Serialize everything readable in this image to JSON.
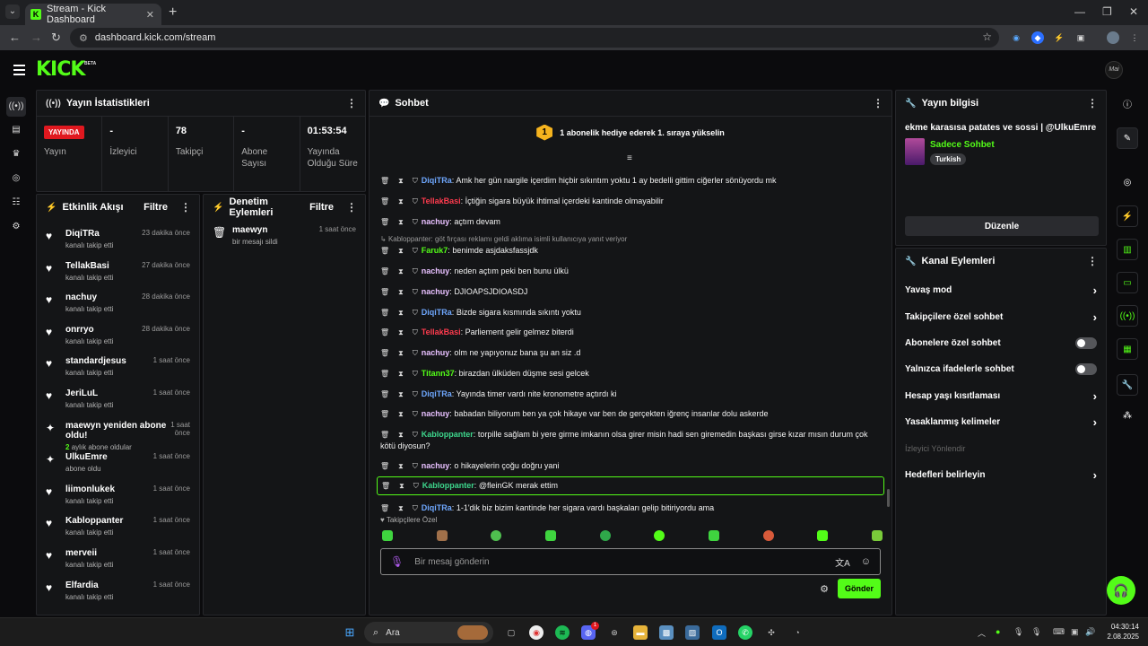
{
  "browser": {
    "tab_title": "Stream - Kick Dashboard",
    "url": "dashboard.kick.com/stream",
    "new_tab": "+",
    "favicon": "K",
    "tab_selector": "⌄"
  },
  "header": {
    "logo": "KICK",
    "beta": "BETA",
    "avatar_text": "Mai"
  },
  "stats": {
    "title": "Yayın İstatistikleri",
    "cells": [
      {
        "value": "YAYINDA",
        "label": "Yayın"
      },
      {
        "value": "-",
        "label": "İzleyici"
      },
      {
        "value": "78",
        "label": "Takipçi"
      },
      {
        "value": "-",
        "label": "Abone Sayısı"
      },
      {
        "value": "01:53:54",
        "label": "Yayında Olduğu Süre"
      }
    ]
  },
  "activity": {
    "title": "Etkinlik Akışı",
    "filter": "Filtre",
    "items": [
      {
        "icon": "heart",
        "name": "DiqiTRa",
        "sub": "kanalı takip etti",
        "time": "23 dakika önce"
      },
      {
        "icon": "heart",
        "name": "TellakBasi",
        "sub": "kanalı takip etti",
        "time": "27 dakika önce"
      },
      {
        "icon": "heart",
        "name": "nachuy",
        "sub": "kanalı takip etti",
        "time": "28 dakika önce"
      },
      {
        "icon": "heart",
        "name": "onrryo",
        "sub": "kanalı takip etti",
        "time": "28 dakika önce"
      },
      {
        "icon": "heart",
        "name": "standardjesus",
        "sub": "kanalı takip etti",
        "time": "1 saat önce"
      },
      {
        "icon": "heart",
        "name": "JeriLuL",
        "sub": "kanalı takip etti",
        "time": "1 saat önce"
      },
      {
        "icon": "sparkle",
        "name": "maewyn yeniden abone oldu!",
        "sub_green": "2",
        "sub": "aylık abone oldular",
        "time": "1 saat önce"
      },
      {
        "icon": "sparkle",
        "name": "UlkuEmre",
        "sub": "abone oldu",
        "time": "1 saat önce"
      },
      {
        "icon": "heart",
        "name": "liimonlukek",
        "sub": "kanalı takip etti",
        "time": "1 saat önce"
      },
      {
        "icon": "heart",
        "name": "Kabloppanter",
        "sub": "kanalı takip etti",
        "time": "1 saat önce"
      },
      {
        "icon": "heart",
        "name": "merveii",
        "sub": "kanalı takip etti",
        "time": "1 saat önce"
      },
      {
        "icon": "heart",
        "name": "Elfardia",
        "sub": "kanalı takip etti",
        "time": "1 saat önce"
      }
    ]
  },
  "moderation": {
    "title": "Denetim Eylemleri",
    "filter": "Filtre",
    "items": [
      {
        "name": "maewyn",
        "sub": "bir mesajı sildi",
        "time": "1 saat önce"
      }
    ]
  },
  "chat": {
    "title": "Sohbet",
    "pinned_badge": "1",
    "pinned_text": "1 abonelik hediye ederek 1. sıraya yükselin",
    "reply_text": "Kabloppanter: göt fırçası reklamı geldi aklıma isimli kullanıcıya yanıt veriyor",
    "messages": [
      {
        "user": "DiqiTRa",
        "color": "#6fa8ff",
        "text": "Amk her gün nargile içerdim hiçbir sıkıntım yoktu 1 ay bedelli gittim ciğerler sönüyordu mk"
      },
      {
        "user": "TellakBasi",
        "color": "#ff3b4e",
        "text": "İçtiğin sigara büyük ihtimal içerdeki kantinde olmayabilir"
      },
      {
        "user": "nachuy",
        "color": "#e8c0ff",
        "text": "açtım devam"
      },
      {
        "user": "Faruk7",
        "color": "#53fc18",
        "text": "benimde asjdaksfassjdk"
      },
      {
        "user": "nachuy",
        "color": "#e8c0ff",
        "text": "neden açtım peki ben bunu ülkü"
      },
      {
        "user": "nachuy",
        "color": "#e8c0ff",
        "text": "DJIOAPSJDIOASDJ"
      },
      {
        "user": "DiqiTRa",
        "color": "#6fa8ff",
        "text": "Bizde sigara kısmında sıkıntı yoktu"
      },
      {
        "user": "TellakBasi",
        "color": "#ff3b4e",
        "text": "Parliement gelir gelmez biterdi"
      },
      {
        "user": "nachuy",
        "color": "#e8c0ff",
        "text": "olm ne yapıyonuz bana şu an siz .d"
      },
      {
        "user": "Titann37",
        "color": "#53fc18",
        "text": "birazdan ülküden düşme sesi gelcek"
      },
      {
        "user": "DiqiTRa",
        "color": "#6fa8ff",
        "text": "Yayında timer vardı nite kronometre açtırdı ki"
      },
      {
        "user": "nachuy",
        "color": "#e8c0ff",
        "text": "babadan biliyorum ben ya çok hikaye var ben de gerçekten iğrenç insanlar dolu askerde"
      },
      {
        "user": "Kabloppanter",
        "color": "#3dd68c",
        "text": "torpille sağlam bi yere girme imkanın olsa girer misin hadi sen giremedin başkası girse kızar mısın durum çok kötü diyosun?"
      },
      {
        "user": "nachuy",
        "color": "#e8c0ff",
        "text": "o hikayelerin çoğu doğru yani"
      },
      {
        "user": "Kabloppanter",
        "color": "#3dd68c",
        "text": "@fleinGK merak ettim"
      },
      {
        "user": "DiqiTRa",
        "color": "#6fa8ff",
        "text": "1-1'dik biz bizim kantinde her sigara vardı başkaları gelip bitiriyordu ama"
      }
    ],
    "followers_only": "Takipçilere Özel",
    "input_placeholder": "Bir mesaj gönderin",
    "send": "Gönder"
  },
  "stream_info": {
    "title": "Yayın bilgisi",
    "stream_title": "ekme karasısa patates ve sossi | @UlkuEmre",
    "category": "Sadece Sohbet",
    "tag": "Turkish",
    "edit": "Düzenle"
  },
  "channel_actions": {
    "title": "Kanal Eylemleri",
    "items": [
      {
        "label": "Yavaş mod",
        "control": "chevron"
      },
      {
        "label": "Takipçilere özel sohbet",
        "control": "chevron"
      },
      {
        "label": "Abonelere özel sohbet",
        "control": "toggle"
      },
      {
        "label": "Yalnızca ifadelerle sohbet",
        "control": "toggle"
      },
      {
        "label": "Hesap yaşı kısıtlaması",
        "control": "chevron"
      },
      {
        "label": "Yasaklanmış kelimeler",
        "control": "chevron"
      },
      {
        "label": "İzleyici Yönlendir",
        "control": "none"
      },
      {
        "label": "Hedefleri belirleyin",
        "control": "chevron"
      }
    ]
  },
  "taskbar": {
    "search": "Ara",
    "time": "04:30:14",
    "date": "2.08.2025",
    "discord_badge": "1"
  },
  "colors": {
    "accent": "#53fc18",
    "live": "#e0181f",
    "bg": "#0b0b0d",
    "panel": "#141517"
  }
}
